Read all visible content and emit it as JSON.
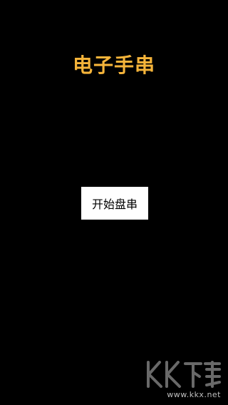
{
  "app": {
    "title": "电子手串",
    "start_button_label": "开始盘串"
  },
  "watermark": {
    "logo_text": "KK下载",
    "url": "www.kkx.net"
  },
  "colors": {
    "background": "#000000",
    "title": "#F5B43A",
    "button_bg": "#FFFFFF",
    "button_text": "#000000",
    "watermark": "#BFBFBF"
  }
}
